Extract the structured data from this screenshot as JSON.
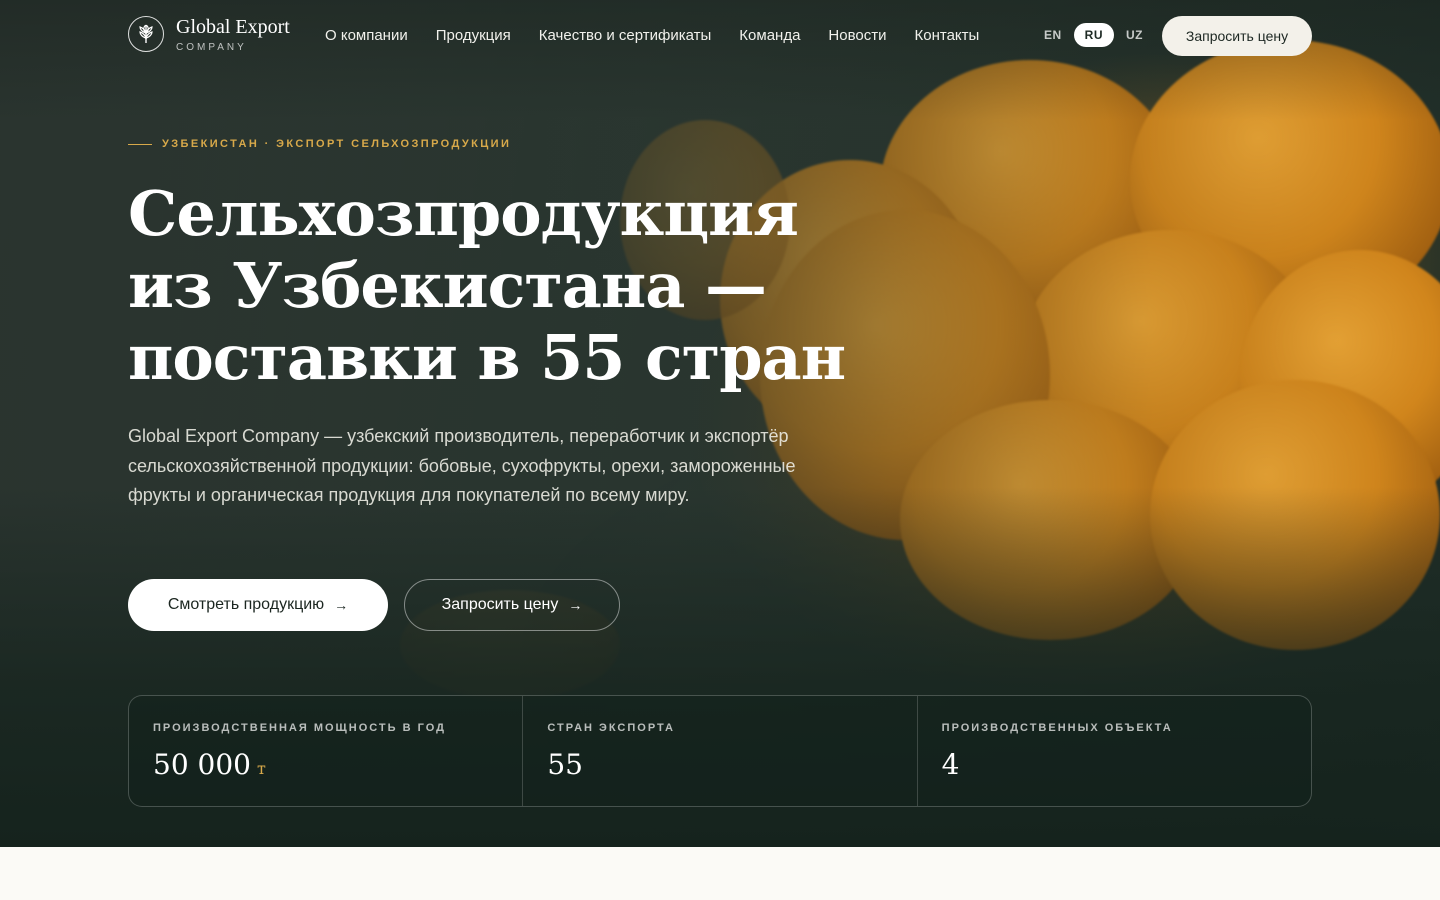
{
  "brand": {
    "name": "Global Export",
    "sub": "COMPANY"
  },
  "nav": [
    "О компании",
    "Продукция",
    "Качество и сертификаты",
    "Команда",
    "Новости",
    "Контакты"
  ],
  "languages": [
    {
      "code": "EN",
      "active": false
    },
    {
      "code": "RU",
      "active": true
    },
    {
      "code": "UZ",
      "active": false
    }
  ],
  "header_cta": "Запросить цену",
  "hero": {
    "eyebrow": "УЗБЕКИСТАН · ЭКСПОРТ СЕЛЬХОЗПРОДУКЦИИ",
    "title_lines": [
      "Сельхозпродукция",
      "из Узбекистана —",
      "поставки в 55 стран"
    ],
    "lead": "Global Export Company — узбекский производитель, переработчик и экспортёр сельскохозяйственной продукции: бобовые, сухофрукты, орехи, замороженные фрукты и органическая продукция для покупателей по всему миру.",
    "primary_button": "Смотреть продукцию",
    "secondary_button": "Запросить цену",
    "arrow": "→"
  },
  "stats": [
    {
      "label": "ПРОИЗВОДСТВЕННАЯ МОЩНОСТЬ В ГОД",
      "value": "50 000",
      "unit": "т"
    },
    {
      "label": "СТРАН ЭКСПОРТА",
      "value": "55",
      "unit": ""
    },
    {
      "label": "ПРОИЗВОДСТВЕННЫХ ОБЪЕКТА",
      "value": "4",
      "unit": ""
    }
  ],
  "colors": {
    "accent": "#d8a94a",
    "dark": "#1e2a25",
    "cream": "#fbfaf6"
  }
}
